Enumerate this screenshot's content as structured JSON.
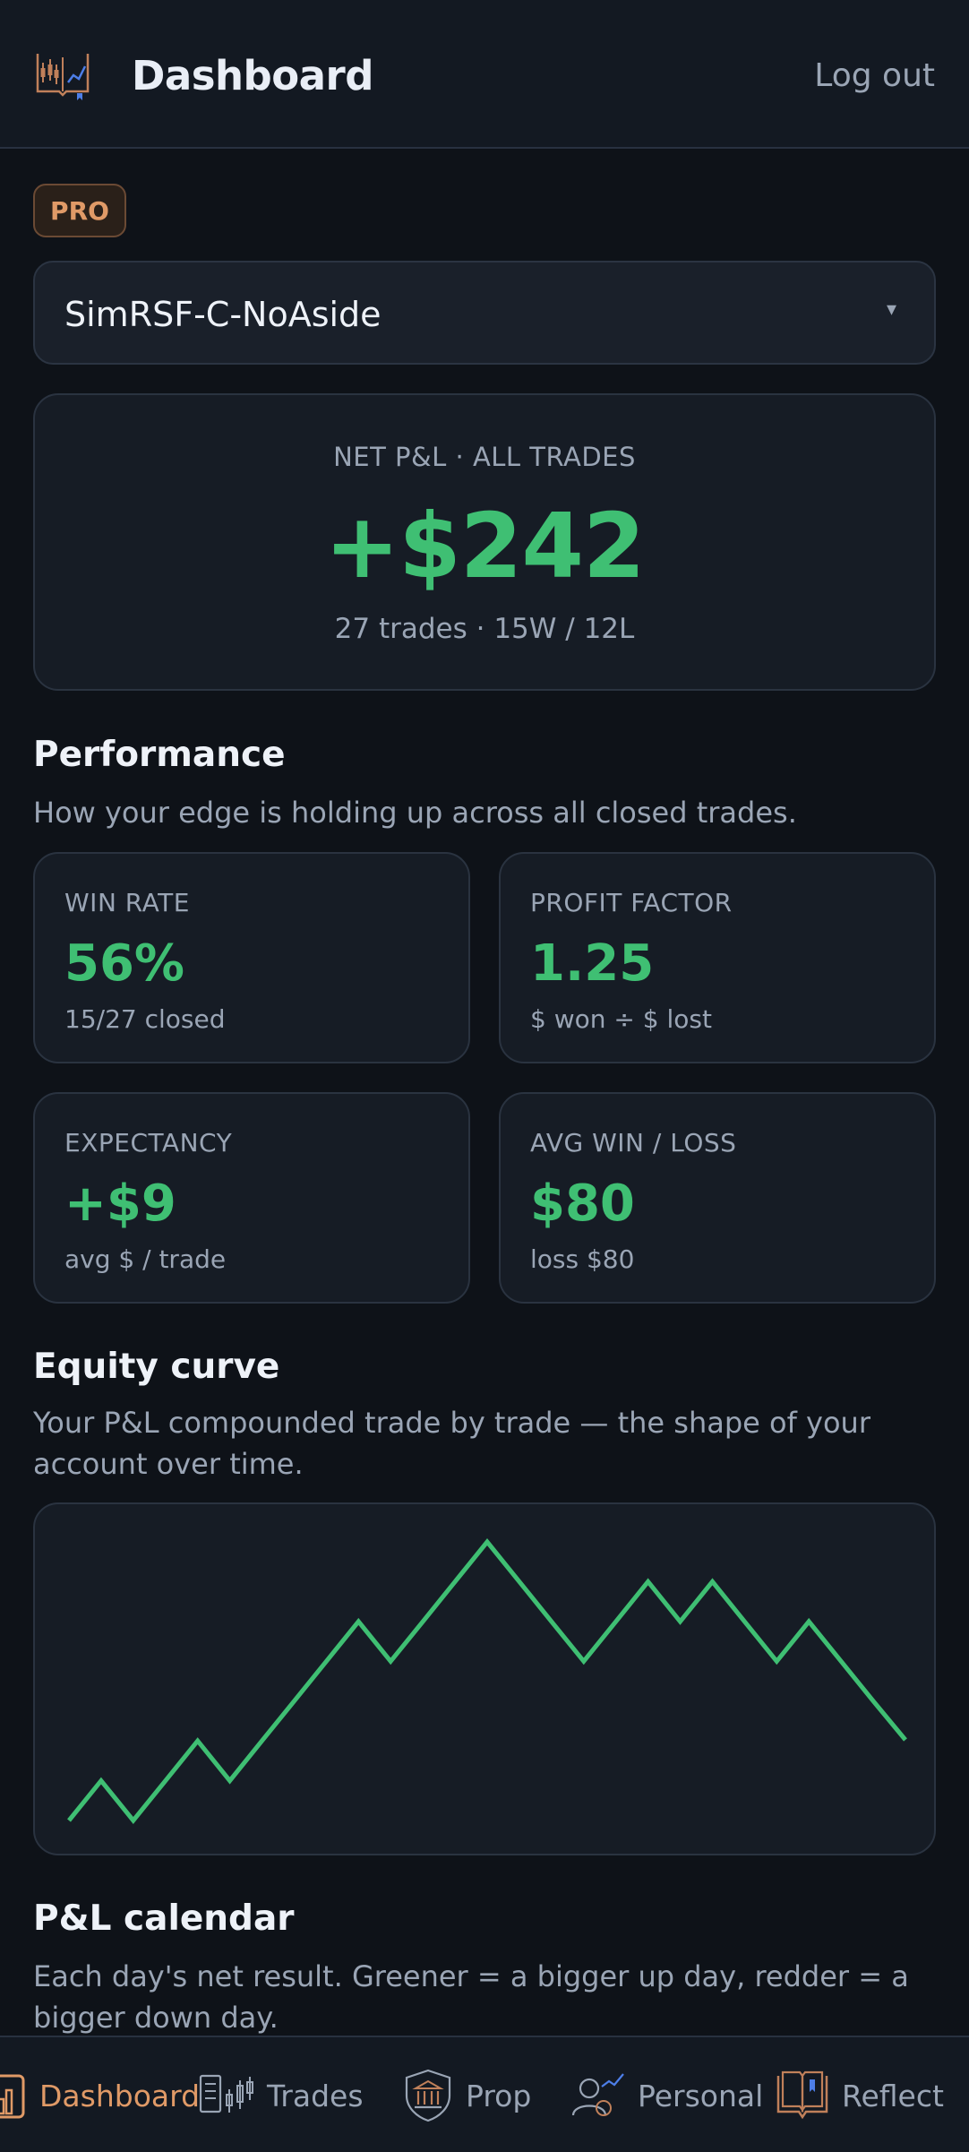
{
  "header": {
    "title": "Dashboard",
    "logout_label": "Log out"
  },
  "badge": "PRO",
  "account_select": {
    "value": "SimRSF-C-NoAside",
    "caret": "▾"
  },
  "summary": {
    "label": "NET P&L · ALL TRADES",
    "value": "+$242",
    "sub": "27 trades · 15W / 12L"
  },
  "performance": {
    "title": "Performance",
    "desc": "How your edge is holding up across all closed trades.",
    "stats": [
      {
        "label": "WIN RATE",
        "value": "56%",
        "sub": "15/27 closed"
      },
      {
        "label": "PROFIT FACTOR",
        "value": "1.25",
        "sub": "$ won ÷ $ lost"
      },
      {
        "label": "EXPECTANCY",
        "value": "+$9",
        "sub": "avg $ / trade"
      },
      {
        "label": "AVG WIN / LOSS",
        "value": "$80",
        "sub": "loss $80"
      }
    ]
  },
  "equity": {
    "title": "Equity curve",
    "desc": "Your P&L compounded trade by trade — the shape of your account over time."
  },
  "chart_data": {
    "type": "line",
    "title": "",
    "xlabel": "",
    "ylabel": "",
    "grid": false,
    "series": [
      {
        "values": [
          0,
          80,
          0,
          80,
          160,
          80,
          160,
          240,
          320,
          400,
          320,
          400,
          480,
          560,
          480,
          400,
          320,
          400,
          480,
          400,
          480,
          400,
          320,
          400,
          320,
          240,
          162
        ]
      }
    ],
    "color": "#3fbf73"
  },
  "calendar": {
    "title": "P&L calendar",
    "desc": "Each day's net result. Greener = a bigger up day, redder = a bigger down day."
  },
  "nav": {
    "items": [
      {
        "label": "Dashboard",
        "icon": "bar-chart-icon"
      },
      {
        "label": "Trades",
        "icon": "candlestick-icon"
      },
      {
        "label": "Prop",
        "icon": "bank-icon"
      },
      {
        "label": "Personal",
        "icon": "user-chart-icon"
      },
      {
        "label": "Reflect",
        "icon": "book-icon"
      }
    ]
  },
  "colors": {
    "accent": "#e09a67",
    "positive": "#3fbf73",
    "background": "#0e1218"
  }
}
